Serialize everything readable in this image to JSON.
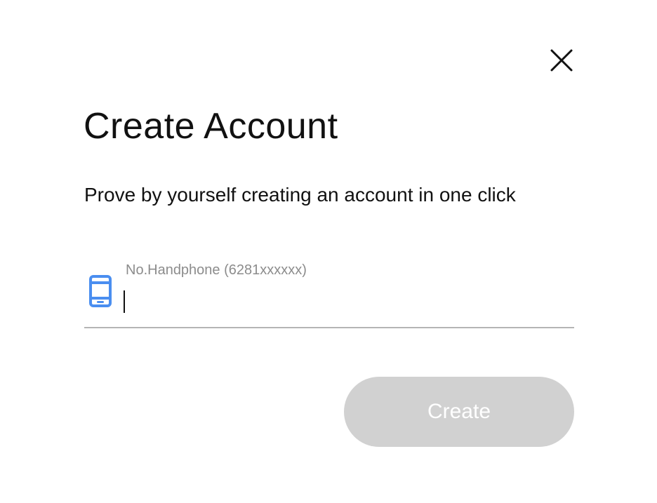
{
  "dialog": {
    "title": "Create Account",
    "subtitle": "Prove by yourself creating an account in one click",
    "close_icon": "close-icon"
  },
  "phone_field": {
    "label": "No.Handphone (6281xxxxxx)",
    "value": "",
    "icon": "smartphone-icon",
    "icon_color": "#4a8ef0"
  },
  "actions": {
    "create_label": "Create",
    "create_bg": "#d1d1d1",
    "create_text_color": "#ffffff"
  }
}
